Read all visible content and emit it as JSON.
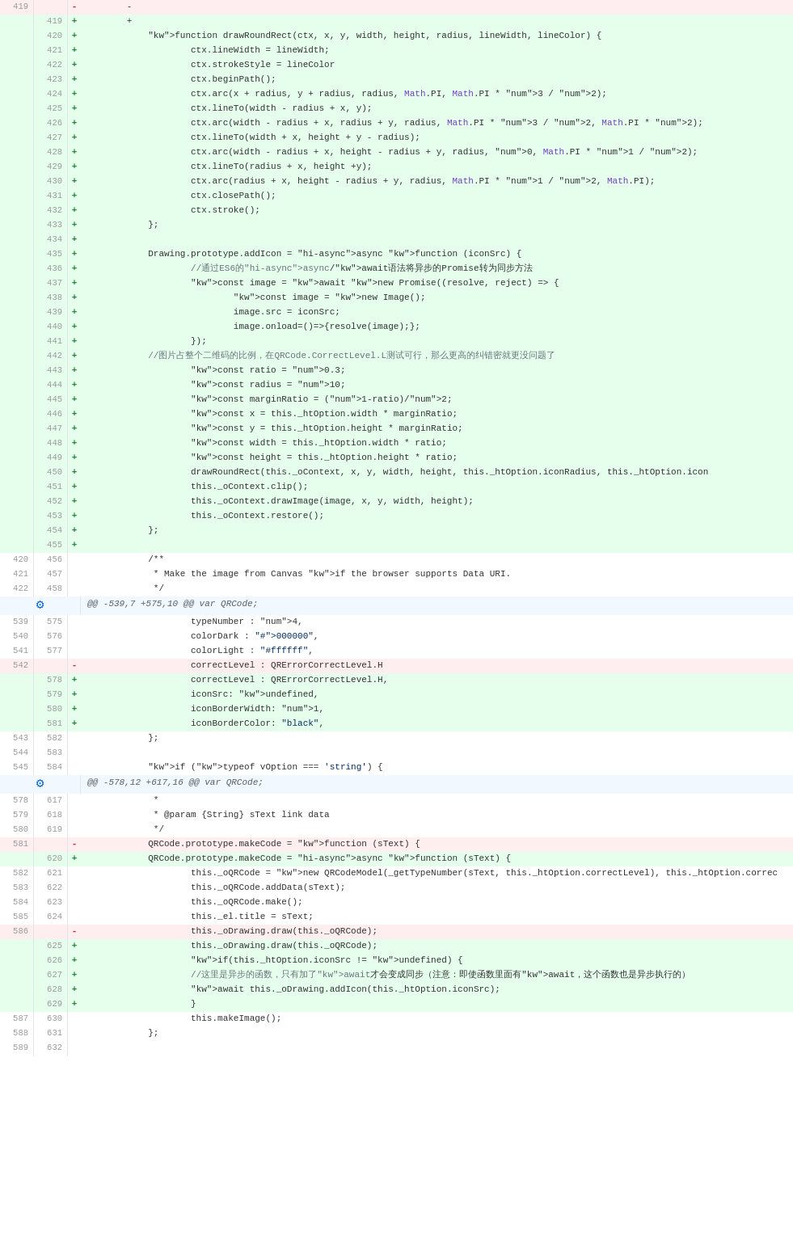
{
  "diff": {
    "hunks": [
      {
        "type": "hunk-header",
        "hunkId": "hunk1",
        "label": "@@ -539,7 +575,10 @@ var QRCode;"
      },
      {
        "type": "hunk-header",
        "hunkId": "hunk2",
        "label": "@@ -578,12 +617,16 @@ var QRCode;"
      }
    ],
    "lines": [
      {
        "old": "419",
        "new": null,
        "sign": "-",
        "type": "removed",
        "text": "        -"
      },
      {
        "old": null,
        "new": "419",
        "sign": "+",
        "type": "added",
        "text": "        +"
      },
      {
        "old": null,
        "new": "420",
        "sign": "+",
        "type": "added",
        "text": "            function drawRoundRect(ctx, x, y, width, height, radius, lineWidth, lineColor) {"
      },
      {
        "old": null,
        "new": "421",
        "sign": "+",
        "type": "added",
        "text": "                    ctx.lineWidth = lineWidth;"
      },
      {
        "old": null,
        "new": "422",
        "sign": "+",
        "type": "added",
        "text": "                    ctx.strokeStyle = lineColor"
      },
      {
        "old": null,
        "new": "423",
        "sign": "+",
        "type": "added",
        "text": "                    ctx.beginPath();"
      },
      {
        "old": null,
        "new": "424",
        "sign": "+",
        "type": "added",
        "text": "                    ctx.arc(x + radius, y + radius, radius, Math.PI, Math.PI * 3 / 2);"
      },
      {
        "old": null,
        "new": "425",
        "sign": "+",
        "type": "added",
        "text": "                    ctx.lineTo(width - radius + x, y);"
      },
      {
        "old": null,
        "new": "426",
        "sign": "+",
        "type": "added",
        "text": "                    ctx.arc(width - radius + x, radius + y, radius, Math.PI * 3 / 2, Math.PI * 2);"
      },
      {
        "old": null,
        "new": "427",
        "sign": "+",
        "type": "added",
        "text": "                    ctx.lineTo(width + x, height + y - radius);"
      },
      {
        "old": null,
        "new": "428",
        "sign": "+",
        "type": "added",
        "text": "                    ctx.arc(width - radius + x, height - radius + y, radius, 0, Math.PI * 1 / 2);"
      },
      {
        "old": null,
        "new": "429",
        "sign": "+",
        "type": "added",
        "text": "                    ctx.lineTo(radius + x, height +y);"
      },
      {
        "old": null,
        "new": "430",
        "sign": "+",
        "type": "added",
        "text": "                    ctx.arc(radius + x, height - radius + y, radius, Math.PI * 1 / 2, Math.PI);"
      },
      {
        "old": null,
        "new": "431",
        "sign": "+",
        "type": "added",
        "text": "                    ctx.closePath();"
      },
      {
        "old": null,
        "new": "432",
        "sign": "+",
        "type": "added",
        "text": "                    ctx.stroke();"
      },
      {
        "old": null,
        "new": "433",
        "sign": "+",
        "type": "added",
        "text": "            };"
      },
      {
        "old": null,
        "new": "434",
        "sign": "+",
        "type": "added",
        "text": ""
      },
      {
        "old": null,
        "new": "435",
        "sign": "+",
        "type": "added",
        "text": "            Drawing.prototype.addIcon = async function (iconSrc) {"
      },
      {
        "old": null,
        "new": "436",
        "sign": "+",
        "type": "added",
        "text": "                    //通过ES6的async/await语法将异步的Promise转为同步方法"
      },
      {
        "old": null,
        "new": "437",
        "sign": "+",
        "type": "added",
        "text": "                    const image = await new Promise((resolve, reject) => {"
      },
      {
        "old": null,
        "new": "438",
        "sign": "+",
        "type": "added",
        "text": "                            const image = new Image();"
      },
      {
        "old": null,
        "new": "439",
        "sign": "+",
        "type": "added",
        "text": "                            image.src = iconSrc;"
      },
      {
        "old": null,
        "new": "440",
        "sign": "+",
        "type": "added",
        "text": "                            image.onload=()=>{resolve(image);};"
      },
      {
        "old": null,
        "new": "441",
        "sign": "+",
        "type": "added",
        "text": "                    });"
      },
      {
        "old": null,
        "new": "442",
        "sign": "+",
        "type": "added",
        "text": "            //图片占整个二维码的比例，在QRCode.CorrectLevel.L测试可行，那么更高的纠错密就更没问题了"
      },
      {
        "old": null,
        "new": "443",
        "sign": "+",
        "type": "added",
        "text": "                    const ratio = 0.3;"
      },
      {
        "old": null,
        "new": "444",
        "sign": "+",
        "type": "added",
        "text": "                    const radius = 10;"
      },
      {
        "old": null,
        "new": "445",
        "sign": "+",
        "type": "added",
        "text": "                    const marginRatio = (1-ratio)/2;"
      },
      {
        "old": null,
        "new": "446",
        "sign": "+",
        "type": "added",
        "text": "                    const x = this._htOption.width * marginRatio;"
      },
      {
        "old": null,
        "new": "447",
        "sign": "+",
        "type": "added",
        "text": "                    const y = this._htOption.height * marginRatio;"
      },
      {
        "old": null,
        "new": "448",
        "sign": "+",
        "type": "added",
        "text": "                    const width = this._htOption.width * ratio;"
      },
      {
        "old": null,
        "new": "449",
        "sign": "+",
        "type": "added",
        "text": "                    const height = this._htOption.height * ratio;"
      },
      {
        "old": null,
        "new": "450",
        "sign": "+",
        "type": "added",
        "text": "                    drawRoundRect(this._oContext, x, y, width, height, this._htOption.iconRadius, this._htOption.icon"
      },
      {
        "old": null,
        "new": "451",
        "sign": "+",
        "type": "added",
        "text": "                    this._oContext.clip();"
      },
      {
        "old": null,
        "new": "452",
        "sign": "+",
        "type": "added",
        "text": "                    this._oContext.drawImage(image, x, y, width, height);"
      },
      {
        "old": null,
        "new": "453",
        "sign": "+",
        "type": "added",
        "text": "                    this._oContext.restore();"
      },
      {
        "old": null,
        "new": "454",
        "sign": "+",
        "type": "added",
        "text": "            };"
      },
      {
        "old": null,
        "new": "455",
        "sign": "+",
        "type": "added",
        "text": ""
      },
      {
        "old": "420",
        "new": "456",
        "sign": " ",
        "type": "context",
        "text": "            /**"
      },
      {
        "old": "421",
        "new": "457",
        "sign": " ",
        "type": "context",
        "text": "             * Make the image from Canvas if the browser supports Data URI."
      },
      {
        "old": "422",
        "new": "458",
        "sign": " ",
        "type": "context",
        "text": "             */"
      },
      {
        "old": null,
        "new": null,
        "sign": " ",
        "type": "hunk-header-row",
        "hunkRef": "hunk1",
        "text": "@@ -539,7 +575,10 @@ var QRCode;"
      },
      {
        "old": "539",
        "new": "575",
        "sign": " ",
        "type": "context",
        "text": "                    typeNumber : 4,"
      },
      {
        "old": "540",
        "new": "576",
        "sign": " ",
        "type": "context",
        "text": "                    colorDark : \"#000000\","
      },
      {
        "old": "541",
        "new": "577",
        "sign": " ",
        "type": "context",
        "text": "                    colorLight : \"#ffffff\","
      },
      {
        "old": "542",
        "new": null,
        "sign": "-",
        "type": "removed",
        "text": "                    correctLevel : QRErrorCorrectLevel.H"
      },
      {
        "old": null,
        "new": "578",
        "sign": "+",
        "type": "added",
        "text": "                    correctLevel : QRErrorCorrectLevel.H,"
      },
      {
        "old": null,
        "new": "579",
        "sign": "+",
        "type": "added",
        "text": "                    iconSrc: undefined,"
      },
      {
        "old": null,
        "new": "580",
        "sign": "+",
        "type": "added",
        "text": "                    iconBorderWidth: 1,"
      },
      {
        "old": null,
        "new": "581",
        "sign": "+",
        "type": "added",
        "text": "                    iconBorderColor: \"black\","
      },
      {
        "old": "543",
        "new": "582",
        "sign": " ",
        "type": "context",
        "text": "            };"
      },
      {
        "old": "544",
        "new": "583",
        "sign": " ",
        "type": "context",
        "text": ""
      },
      {
        "old": "545",
        "new": "584",
        "sign": " ",
        "type": "context",
        "text": "            if (typeof vOption === 'string') {"
      },
      {
        "old": null,
        "new": null,
        "sign": " ",
        "type": "hunk-header-row",
        "hunkRef": "hunk2",
        "text": "@@ -578,12 +617,16 @@ var QRCode;"
      },
      {
        "old": "578",
        "new": "617",
        "sign": " ",
        "type": "context",
        "text": "             *"
      },
      {
        "old": "579",
        "new": "618",
        "sign": " ",
        "type": "context",
        "text": "             * @param {String} sText link data"
      },
      {
        "old": "580",
        "new": "619",
        "sign": " ",
        "type": "context",
        "text": "             */"
      },
      {
        "old": "581",
        "new": null,
        "sign": "-",
        "type": "removed",
        "text": "            QRCode.prototype.makeCode = function (sText) {"
      },
      {
        "old": null,
        "new": "620",
        "sign": "+",
        "type": "added",
        "text": "            QRCode.prototype.makeCode = async function (sText) {"
      },
      {
        "old": "582",
        "new": "621",
        "sign": " ",
        "type": "context",
        "text": "                    this._oQRCode = new QRCodeModel(_getTypeNumber(sText, this._htOption.correctLevel), this._htOption.correc"
      },
      {
        "old": "583",
        "new": "622",
        "sign": " ",
        "type": "context",
        "text": "                    this._oQRCode.addData(sText);"
      },
      {
        "old": "584",
        "new": "623",
        "sign": " ",
        "type": "context",
        "text": "                    this._oQRCode.make();"
      },
      {
        "old": "585",
        "new": "624",
        "sign": " ",
        "type": "context",
        "text": "                    this._el.title = sText;"
      },
      {
        "old": "586",
        "new": null,
        "sign": "-",
        "type": "removed",
        "text": "                    this._oDrawing.draw(this._oQRCode);"
      },
      {
        "old": null,
        "new": "625",
        "sign": "+",
        "type": "added",
        "text": "                    this._oDrawing.draw(this._oQRCode);"
      },
      {
        "old": null,
        "new": "626",
        "sign": "+",
        "type": "added",
        "text": "                    if(this._htOption.iconSrc != undefined) {"
      },
      {
        "old": null,
        "new": "627",
        "sign": "+",
        "type": "added",
        "text": "                    //这里是异步的函数，只有加了await才会变成同步（注意：即使函数里面有await，这个函数也是异步执行的）"
      },
      {
        "old": null,
        "new": "628",
        "sign": "+",
        "type": "added",
        "text": "                    await this._oDrawing.addIcon(this._htOption.iconSrc);"
      },
      {
        "old": null,
        "new": "629",
        "sign": "+",
        "type": "added",
        "text": "                    }"
      },
      {
        "old": "587",
        "new": "630",
        "sign": " ",
        "type": "context",
        "text": "                    this.makeImage();"
      },
      {
        "old": "588",
        "new": "631",
        "sign": " ",
        "type": "context",
        "text": "            };"
      },
      {
        "old": "589",
        "new": "632",
        "sign": " ",
        "type": "context",
        "text": ""
      }
    ]
  }
}
